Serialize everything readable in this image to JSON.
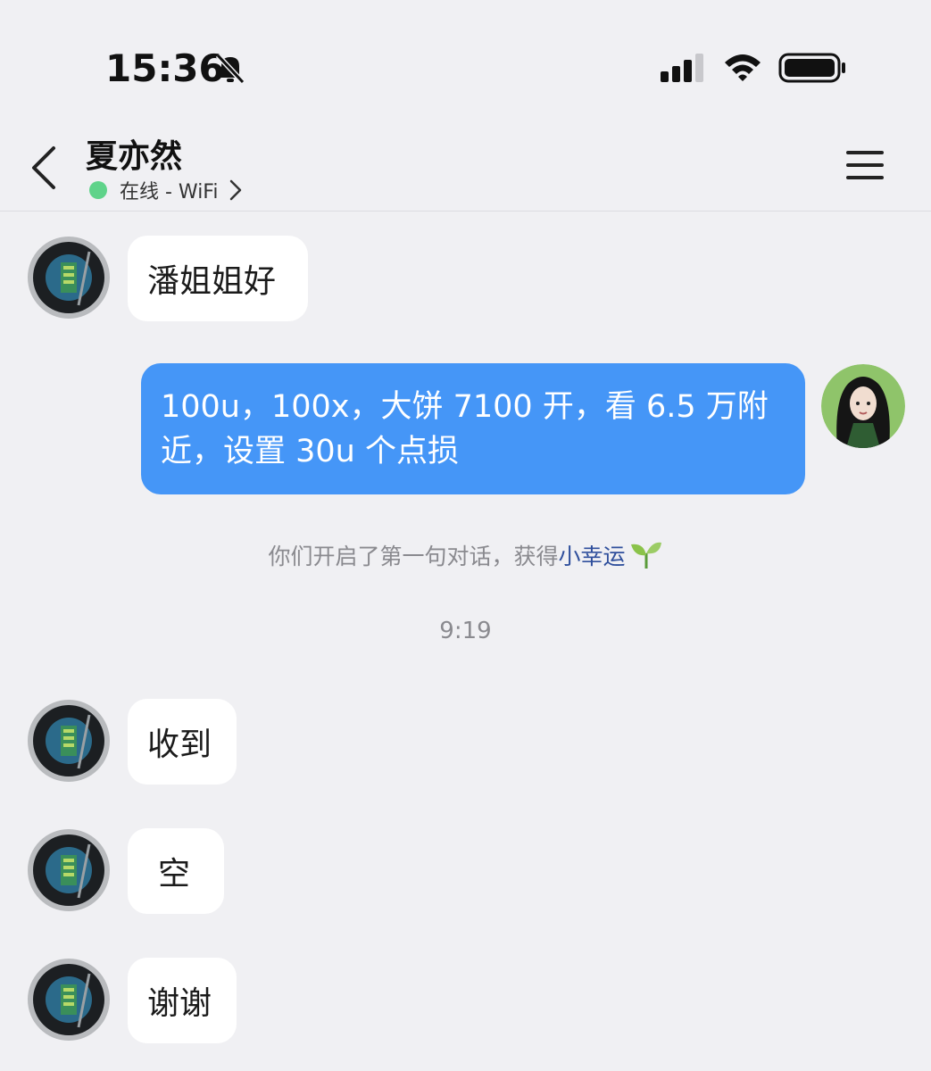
{
  "status_bar": {
    "time": "15:36",
    "icons": [
      "bell-off-icon",
      "signal-icon",
      "wifi-icon",
      "battery-icon"
    ]
  },
  "header": {
    "contact_name": "夏亦然",
    "presence": "在线 - WiFi",
    "presence_color": "#5fd38a",
    "icons": [
      "back-chevron-icon",
      "chevron-right-icon",
      "menu-icon"
    ]
  },
  "messages": [
    {
      "from": "contact",
      "text": "潘姐姐好"
    },
    {
      "from": "self",
      "text": "100u，100x，大饼 7100 开，看 6.5 万附近，设置 30u 个点损"
    },
    {
      "from": "contact",
      "text": "收到"
    },
    {
      "from": "contact",
      "text": "空"
    },
    {
      "from": "contact",
      "text": "谢谢"
    }
  ],
  "system_note": {
    "prefix": "你们开启了第一句对话，获得",
    "highlight": "小幸运",
    "icon": "sprout-icon"
  },
  "timestamp": "9:19",
  "colors": {
    "background": "#f0f0f3",
    "self_bubble": "#4596f7",
    "contact_bubble": "#ffffff",
    "highlight_link": "#2f4f9c"
  }
}
